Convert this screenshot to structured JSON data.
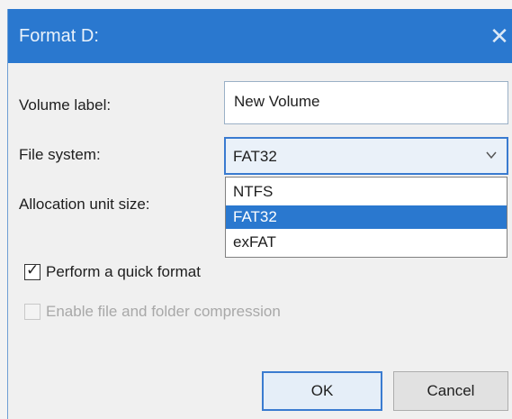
{
  "window": {
    "title": "Format D:",
    "close_glyph": "✕"
  },
  "fields": {
    "volume_label": {
      "label": "Volume label:",
      "value": "New Volume"
    },
    "file_system": {
      "label": "File system:",
      "value": "FAT32",
      "options": [
        "NTFS",
        "FAT32",
        "exFAT"
      ],
      "highlighted_option": "FAT32"
    },
    "allocation_unit_size": {
      "label": "Allocation unit size:"
    }
  },
  "options": {
    "quick_format": {
      "label": "Perform a quick format",
      "checked": true,
      "enabled": true
    },
    "compression": {
      "label": "Enable file and folder compression",
      "checked": false,
      "enabled": false
    }
  },
  "buttons": {
    "ok": "OK",
    "cancel": "Cancel"
  },
  "colors": {
    "titlebar": "#2a78cf",
    "selection": "#2a78cf",
    "dialog_background": "#f0f0f0"
  },
  "icons": {
    "close": "close-icon",
    "dropdown": "chevron-down-icon",
    "check": "checkmark-icon"
  }
}
